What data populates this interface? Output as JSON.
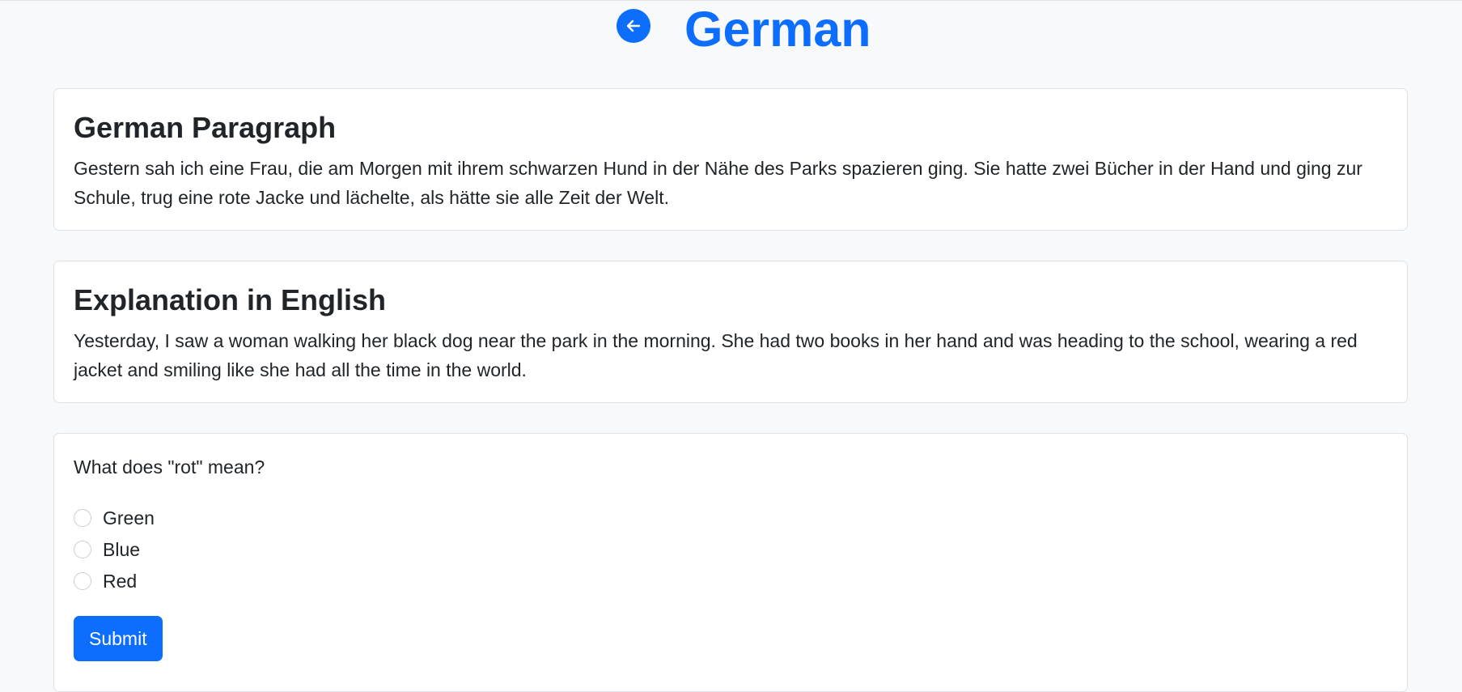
{
  "header": {
    "back_icon": "arrow-left-icon",
    "title": "German"
  },
  "german_section": {
    "title": "German Paragraph",
    "text": "Gestern sah ich eine Frau, die am Morgen mit ihrem schwarzen Hund in der Nähe des Parks spazieren ging. Sie hatte zwei Bücher in der Hand und ging zur Schule, trug eine rote Jacke und lächelte, als hätte sie alle Zeit der Welt."
  },
  "english_section": {
    "title": "Explanation in English",
    "text": "Yesterday, I saw a woman walking her black dog near the park in the morning. She had two books in her hand and was heading to the school, wearing a red jacket and smiling like she had all the time in the world."
  },
  "quiz": {
    "question": "What does \"rot\" mean?",
    "options": [
      {
        "label": "Green",
        "selected": false
      },
      {
        "label": "Blue",
        "selected": false
      },
      {
        "label": "Red",
        "selected": false
      }
    ],
    "submit_label": "Submit"
  },
  "colors": {
    "accent": "#0d6efd",
    "background": "#f8f9fa",
    "card": "#ffffff",
    "text": "#212529"
  }
}
